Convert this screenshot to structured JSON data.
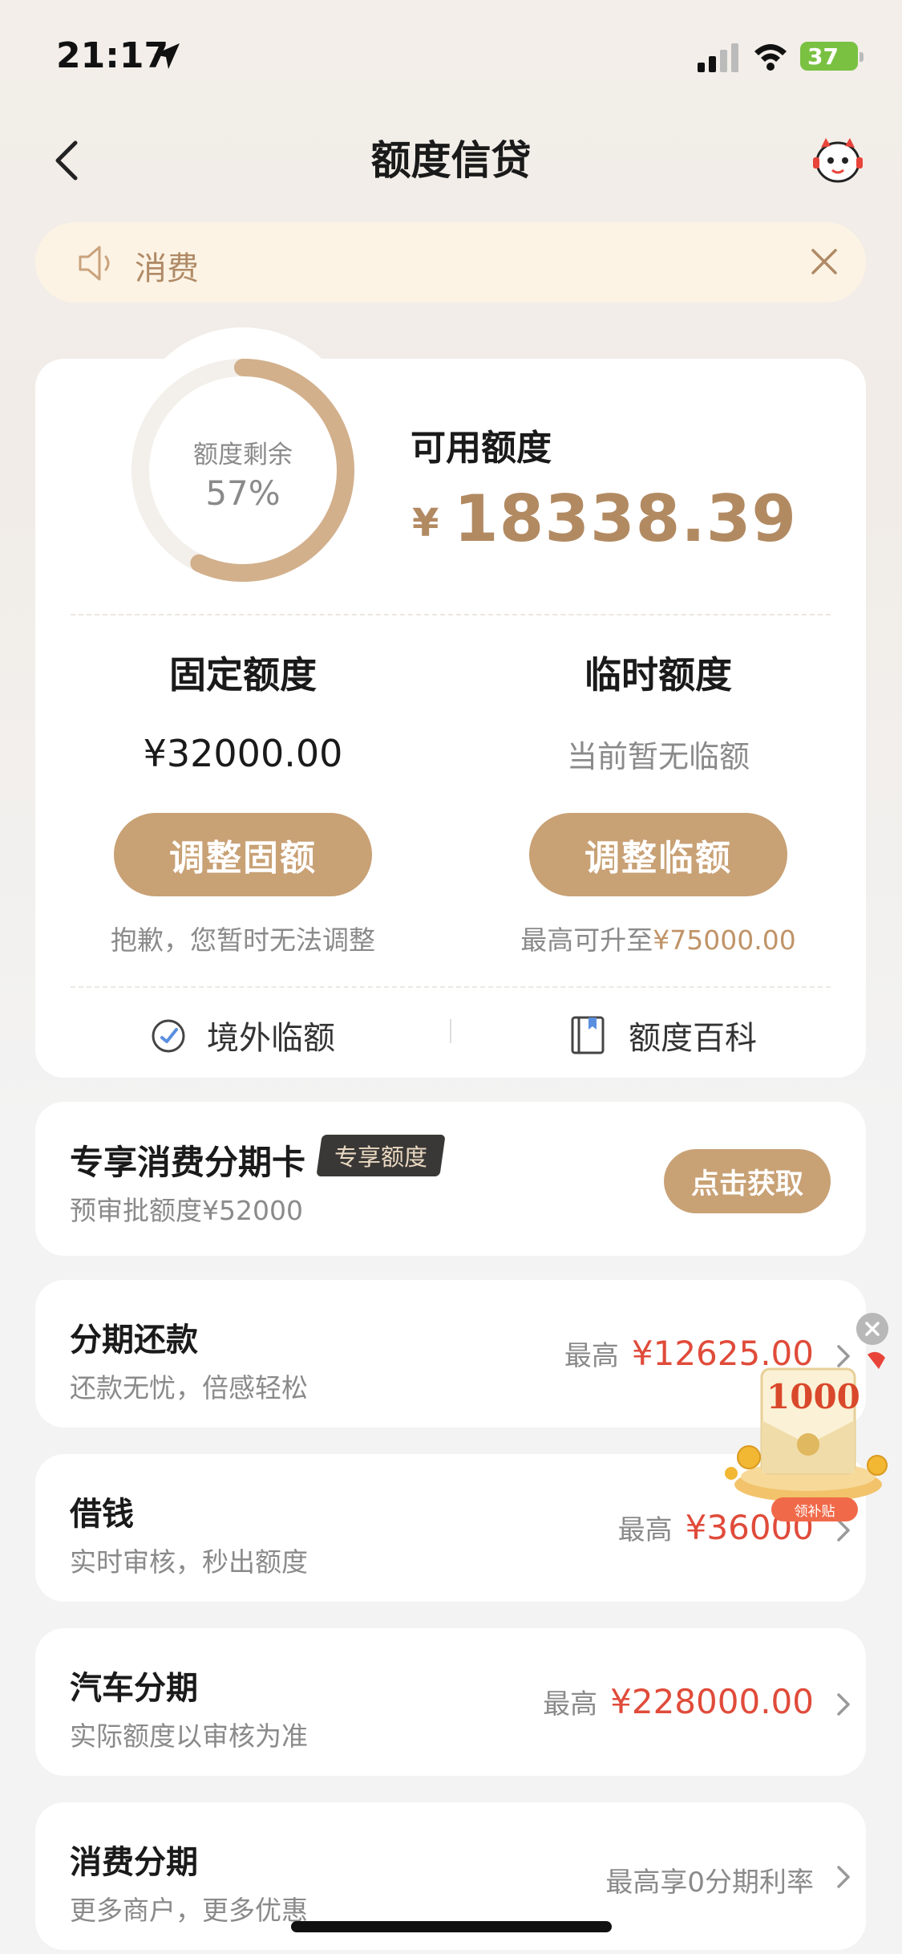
{
  "status_bar": {
    "time": "21:17",
    "battery": "37"
  },
  "nav": {
    "title": "额度信贷"
  },
  "notice": {
    "text": "消费"
  },
  "quota": {
    "ring_label": "额度剩余",
    "ring_percent": "57%",
    "ring_fraction": 0.57,
    "available_label": "可用额度",
    "currency_symbol": "¥",
    "available_amount": "18338.39"
  },
  "fixed": {
    "title": "固定额度",
    "amount": "¥32000.00",
    "button_label": "调整固额",
    "hint": "抱歉，您暂时无法调整"
  },
  "temporary": {
    "title": "临时额度",
    "status": "当前暂无临额",
    "button_label": "调整临额",
    "hint_prefix": "最高可升至",
    "hint_amount": "¥75000.00"
  },
  "links": [
    {
      "label": "境外临额",
      "icon": "overseas-clock-icon"
    },
    {
      "label": "额度百科",
      "icon": "book-icon"
    }
  ],
  "card_offer": {
    "title": "专享消费分期卡",
    "badge": "专享额度",
    "subtitle": "预审批额度¥52000",
    "button_label": "点击获取"
  },
  "products": [
    {
      "title": "分期还款",
      "subtitle": "还款无忧，倍感轻松",
      "prefix": "最高",
      "value": "¥12625.00"
    },
    {
      "title": "借钱",
      "subtitle": "实时审核，秒出额度",
      "prefix": "最高",
      "value": "¥36000"
    },
    {
      "title": "汽车分期",
      "subtitle": "实际额度以审核为准",
      "prefix": "最高",
      "value": "¥228000.00"
    },
    {
      "title": "消费分期",
      "subtitle": "更多商户，更多优惠",
      "note": "最高享0分期利率"
    }
  ],
  "promo": {
    "number": "1000",
    "tag": "领补贴"
  },
  "colors": {
    "gold": "#c8a175",
    "gold_text": "#b28a62",
    "red": "#e04b3a",
    "notice_bg": "#fcf3e4"
  }
}
